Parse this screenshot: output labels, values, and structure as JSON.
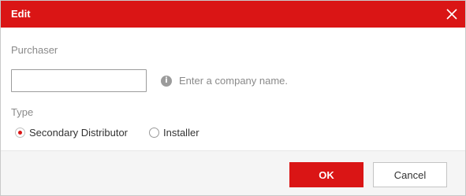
{
  "dialog": {
    "title": "Edit",
    "close_icon": "close-icon",
    "accent_color": "#da1515"
  },
  "form": {
    "purchaser_label": "Purchaser",
    "purchaser_value": "",
    "hint_icon": "info-icon",
    "hint_text": "Enter a company name.",
    "type_label": "Type",
    "type_options": [
      {
        "label": "Secondary Distributor",
        "checked": true
      },
      {
        "label": "Installer",
        "checked": false
      }
    ]
  },
  "footer": {
    "ok_label": "OK",
    "cancel_label": "Cancel"
  }
}
